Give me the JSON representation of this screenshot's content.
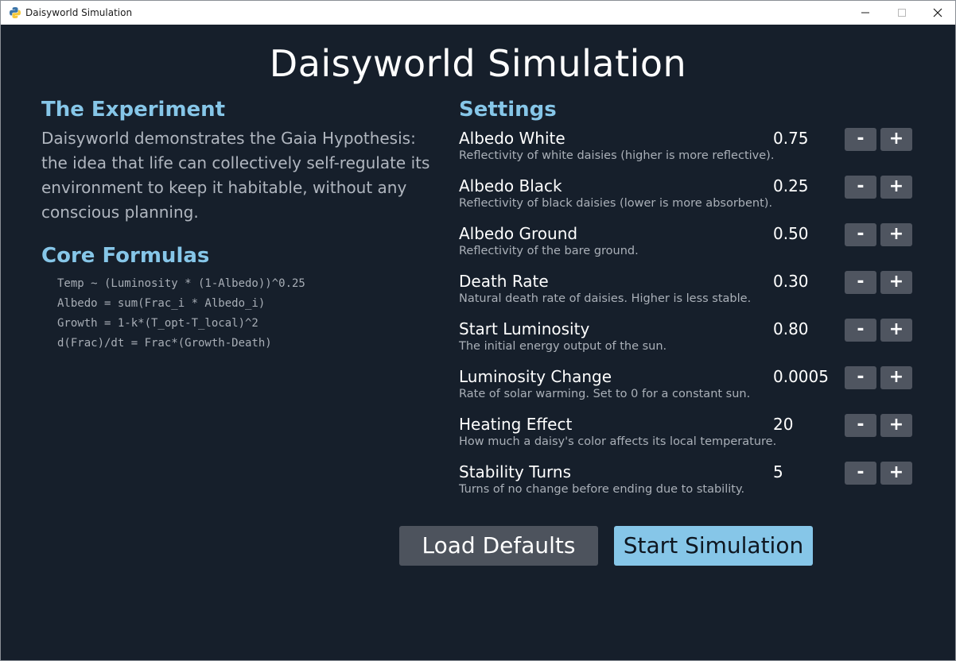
{
  "window": {
    "title": "Daisyworld Simulation"
  },
  "app": {
    "title": "Daisyworld Simulation"
  },
  "experiment": {
    "heading": "The Experiment",
    "text": "Daisyworld demonstrates the Gaia Hypothesis: the idea that life can collectively self-regulate its environment to keep it habitable, without any conscious planning."
  },
  "formulas": {
    "heading": "Core Formulas",
    "lines": [
      "Temp ~ (Luminosity * (1-Albedo))^0.25",
      "Albedo = sum(Frac_i * Albedo_i)",
      "Growth = 1-k*(T_opt-T_local)^2",
      "d(Frac)/dt = Frac*(Growth-Death)"
    ]
  },
  "settings": {
    "heading": "Settings",
    "minus_label": "-",
    "plus_label": "+",
    "items": [
      {
        "label": "Albedo White",
        "description": "Reflectivity of white daisies (higher is more reflective).",
        "value": "0.75"
      },
      {
        "label": "Albedo Black",
        "description": "Reflectivity of black daisies (lower is more absorbent).",
        "value": "0.25"
      },
      {
        "label": "Albedo Ground",
        "description": "Reflectivity of the bare ground.",
        "value": "0.50"
      },
      {
        "label": "Death Rate",
        "description": "Natural death rate of daisies. Higher is less stable.",
        "value": "0.30"
      },
      {
        "label": "Start Luminosity",
        "description": "The initial energy output of the sun.",
        "value": "0.80"
      },
      {
        "label": "Luminosity Change",
        "description": "Rate of solar warming. Set to 0 for a constant sun.",
        "value": "0.0005"
      },
      {
        "label": "Heating Effect",
        "description": "How much a daisy's color affects its local temperature.",
        "value": "20"
      },
      {
        "label": "Stability Turns",
        "description": "Turns of no change before ending due to stability.",
        "value": "5"
      }
    ]
  },
  "actions": {
    "load_defaults": "Load Defaults",
    "start_simulation": "Start Simulation"
  },
  "colors": {
    "background": "#161f2b",
    "accent": "#86c6e8",
    "button": "#4f5560"
  }
}
